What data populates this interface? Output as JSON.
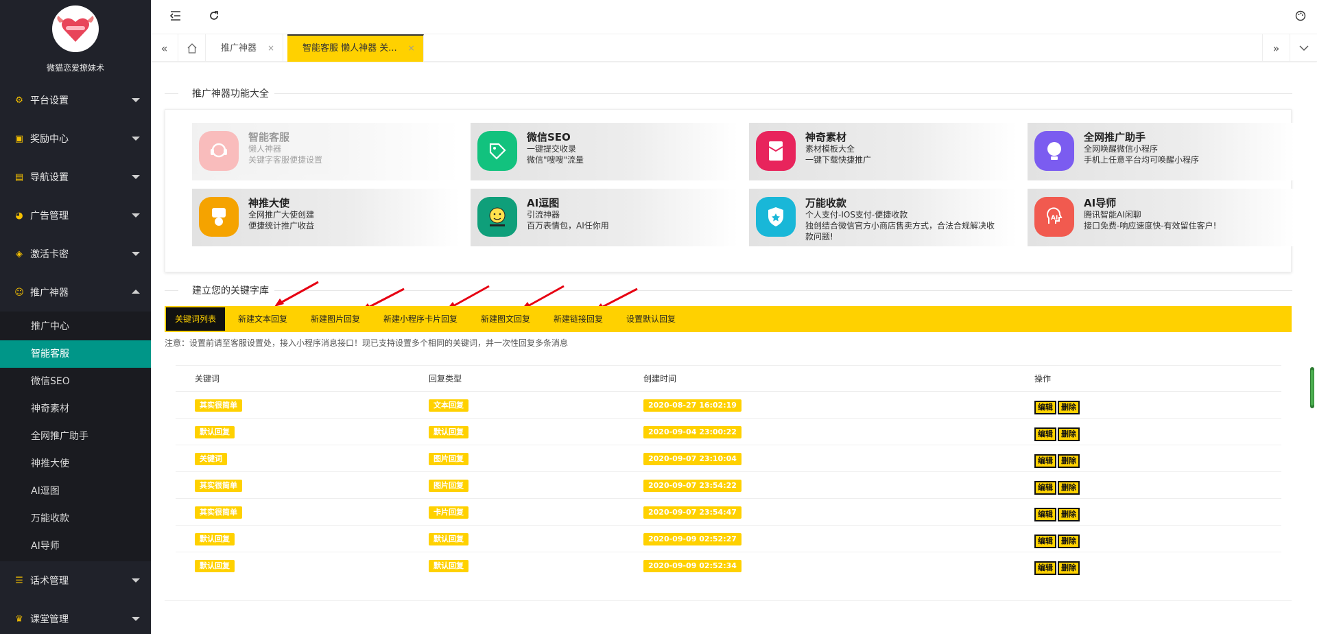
{
  "brand": {
    "name": "微猫恋爱撩妹术"
  },
  "sidebar": {
    "items": [
      {
        "label": "平台设置",
        "icon": "gear-icon"
      },
      {
        "label": "奖励中心",
        "icon": "gift-icon"
      },
      {
        "label": "导航设置",
        "icon": "book-icon"
      },
      {
        "label": "广告管理",
        "icon": "palette-icon"
      },
      {
        "label": "激活卡密",
        "icon": "box-icon"
      },
      {
        "label": "推广神器",
        "icon": "smile-icon"
      }
    ],
    "subitems": [
      "推广中心",
      "智能客服",
      "微信SEO",
      "神奇素材",
      "全网推广助手",
      "神推大使",
      "AI逗图",
      "万能收款",
      "AI导师"
    ],
    "active_sub": "智能客服",
    "bottom_items": [
      {
        "label": "话术管理",
        "icon": "list-icon"
      },
      {
        "label": "课堂管理",
        "icon": "crown-icon"
      }
    ]
  },
  "tabs": {
    "items": [
      {
        "label": "推广神器"
      },
      {
        "label": "智能客服 懒人神器 关..."
      }
    ],
    "close_symbol": "×"
  },
  "features": {
    "section_title": "推广神器功能大全",
    "cards": [
      {
        "title": "智能客服",
        "lines": [
          "懒人神器",
          "关键字客服便捷设置"
        ],
        "color": "#f36c6c",
        "icon": "headset-icon"
      },
      {
        "title": "微信SEO",
        "lines": [
          "一键提交收录",
          "微信\"嗖嗖\"流量"
        ],
        "color": "#12c27e",
        "icon": "tag-icon"
      },
      {
        "title": "神奇素材",
        "lines": [
          "素材模板大全",
          "一键下载快捷推广"
        ],
        "color": "#e8245c",
        "icon": "envelope-icon"
      },
      {
        "title": "全网推广助手",
        "lines": [
          "全网唤醒微信小程序",
          "手机上任意平台均可唤醒小程序"
        ],
        "color": "#7b5cf0",
        "icon": "bulb-icon"
      },
      {
        "title": "神推大使",
        "lines": [
          "全网推广大使创建",
          "便捷统计推广收益"
        ],
        "color": "#f5a300",
        "icon": "medal-icon"
      },
      {
        "title": "AI逗图",
        "lines": [
          "引流神器",
          "百万表情包，AI任你用"
        ],
        "color": "#0f9f7a",
        "icon": "emoji-icon"
      },
      {
        "title": "万能收款",
        "lines": [
          "个人支付-IOS支付-便捷收款",
          "独创结合微信官方小商店售卖方式，合法合规解决收",
          "款问题!"
        ],
        "color": "#19b7d8",
        "icon": "shield-icon"
      },
      {
        "title": "AI导师",
        "lines": [
          "腾讯智能AI闲聊",
          "接口免费-响应速度快-有效留住客户!"
        ],
        "color": "#f15a4f",
        "icon": "ai-head-icon"
      }
    ]
  },
  "keywords": {
    "section_title": "建立您的关键字库",
    "buttons": [
      "关键词列表",
      "新建文本回复",
      "新建图片回复",
      "新建小程序卡片回复",
      "新建图文回复",
      "新建链接回复",
      "设置默认回复"
    ],
    "note": "注意：设置前请至客服设置处，接入小程序消息接口！现已支持设置多个相同的关键词，并一次性回复多条消息",
    "columns": [
      "关键词",
      "回复类型",
      "创建时间",
      "操作"
    ],
    "rows": [
      {
        "keyword": "其实很简单",
        "type": "文本回复",
        "time": "2020-08-27 16:02:19"
      },
      {
        "keyword": "默认回复",
        "type": "默认回复",
        "time": "2020-09-04 23:00:22"
      },
      {
        "keyword": "关键词",
        "type": "图片回复",
        "time": "2020-09-07 23:10:04"
      },
      {
        "keyword": "其实很简单",
        "type": "图片回复",
        "time": "2020-09-07 23:54:22"
      },
      {
        "keyword": "其实很简单",
        "type": "卡片回复",
        "time": "2020-09-07 23:54:47"
      },
      {
        "keyword": "默认回复",
        "type": "默认回复",
        "time": "2020-09-09 02:52:27"
      },
      {
        "keyword": "默认回复",
        "type": "默认回复",
        "time": "2020-09-09 02:52:34"
      }
    ],
    "edit_label": "编辑",
    "delete_label": "删除"
  },
  "colors": {
    "accent": "#ffd100",
    "sidebar_bg": "#20222a",
    "active_green": "#009688"
  }
}
